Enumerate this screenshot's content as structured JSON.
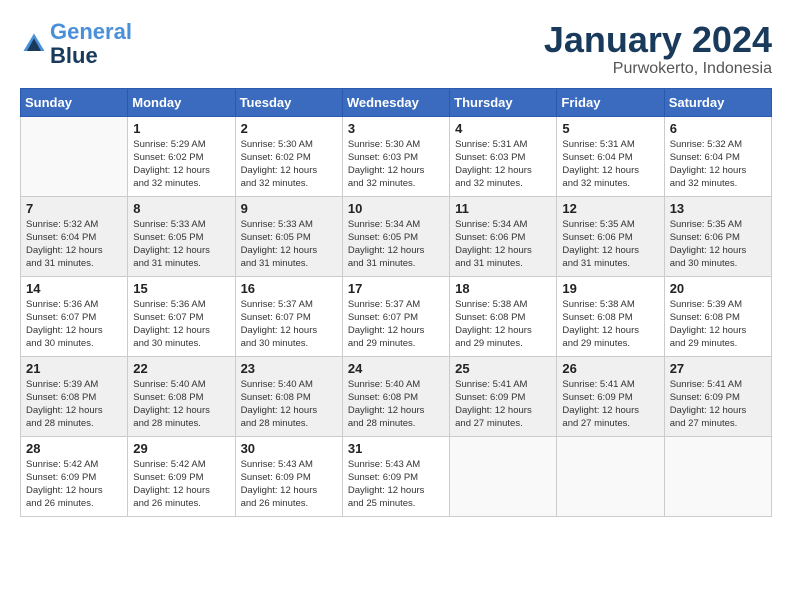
{
  "logo": {
    "line1": "General",
    "line2": "Blue"
  },
  "title": "January 2024",
  "subtitle": "Purwokerto, Indonesia",
  "days_of_week": [
    "Sunday",
    "Monday",
    "Tuesday",
    "Wednesday",
    "Thursday",
    "Friday",
    "Saturday"
  ],
  "weeks": [
    [
      {
        "day": "",
        "info": ""
      },
      {
        "day": "1",
        "info": "Sunrise: 5:29 AM\nSunset: 6:02 PM\nDaylight: 12 hours\nand 32 minutes."
      },
      {
        "day": "2",
        "info": "Sunrise: 5:30 AM\nSunset: 6:02 PM\nDaylight: 12 hours\nand 32 minutes."
      },
      {
        "day": "3",
        "info": "Sunrise: 5:30 AM\nSunset: 6:03 PM\nDaylight: 12 hours\nand 32 minutes."
      },
      {
        "day": "4",
        "info": "Sunrise: 5:31 AM\nSunset: 6:03 PM\nDaylight: 12 hours\nand 32 minutes."
      },
      {
        "day": "5",
        "info": "Sunrise: 5:31 AM\nSunset: 6:04 PM\nDaylight: 12 hours\nand 32 minutes."
      },
      {
        "day": "6",
        "info": "Sunrise: 5:32 AM\nSunset: 6:04 PM\nDaylight: 12 hours\nand 32 minutes."
      }
    ],
    [
      {
        "day": "7",
        "info": "Sunrise: 5:32 AM\nSunset: 6:04 PM\nDaylight: 12 hours\nand 31 minutes."
      },
      {
        "day": "8",
        "info": "Sunrise: 5:33 AM\nSunset: 6:05 PM\nDaylight: 12 hours\nand 31 minutes."
      },
      {
        "day": "9",
        "info": "Sunrise: 5:33 AM\nSunset: 6:05 PM\nDaylight: 12 hours\nand 31 minutes."
      },
      {
        "day": "10",
        "info": "Sunrise: 5:34 AM\nSunset: 6:05 PM\nDaylight: 12 hours\nand 31 minutes."
      },
      {
        "day": "11",
        "info": "Sunrise: 5:34 AM\nSunset: 6:06 PM\nDaylight: 12 hours\nand 31 minutes."
      },
      {
        "day": "12",
        "info": "Sunrise: 5:35 AM\nSunset: 6:06 PM\nDaylight: 12 hours\nand 31 minutes."
      },
      {
        "day": "13",
        "info": "Sunrise: 5:35 AM\nSunset: 6:06 PM\nDaylight: 12 hours\nand 30 minutes."
      }
    ],
    [
      {
        "day": "14",
        "info": "Sunrise: 5:36 AM\nSunset: 6:07 PM\nDaylight: 12 hours\nand 30 minutes."
      },
      {
        "day": "15",
        "info": "Sunrise: 5:36 AM\nSunset: 6:07 PM\nDaylight: 12 hours\nand 30 minutes."
      },
      {
        "day": "16",
        "info": "Sunrise: 5:37 AM\nSunset: 6:07 PM\nDaylight: 12 hours\nand 30 minutes."
      },
      {
        "day": "17",
        "info": "Sunrise: 5:37 AM\nSunset: 6:07 PM\nDaylight: 12 hours\nand 29 minutes."
      },
      {
        "day": "18",
        "info": "Sunrise: 5:38 AM\nSunset: 6:08 PM\nDaylight: 12 hours\nand 29 minutes."
      },
      {
        "day": "19",
        "info": "Sunrise: 5:38 AM\nSunset: 6:08 PM\nDaylight: 12 hours\nand 29 minutes."
      },
      {
        "day": "20",
        "info": "Sunrise: 5:39 AM\nSunset: 6:08 PM\nDaylight: 12 hours\nand 29 minutes."
      }
    ],
    [
      {
        "day": "21",
        "info": "Sunrise: 5:39 AM\nSunset: 6:08 PM\nDaylight: 12 hours\nand 28 minutes."
      },
      {
        "day": "22",
        "info": "Sunrise: 5:40 AM\nSunset: 6:08 PM\nDaylight: 12 hours\nand 28 minutes."
      },
      {
        "day": "23",
        "info": "Sunrise: 5:40 AM\nSunset: 6:08 PM\nDaylight: 12 hours\nand 28 minutes."
      },
      {
        "day": "24",
        "info": "Sunrise: 5:40 AM\nSunset: 6:08 PM\nDaylight: 12 hours\nand 28 minutes."
      },
      {
        "day": "25",
        "info": "Sunrise: 5:41 AM\nSunset: 6:09 PM\nDaylight: 12 hours\nand 27 minutes."
      },
      {
        "day": "26",
        "info": "Sunrise: 5:41 AM\nSunset: 6:09 PM\nDaylight: 12 hours\nand 27 minutes."
      },
      {
        "day": "27",
        "info": "Sunrise: 5:41 AM\nSunset: 6:09 PM\nDaylight: 12 hours\nand 27 minutes."
      }
    ],
    [
      {
        "day": "28",
        "info": "Sunrise: 5:42 AM\nSunset: 6:09 PM\nDaylight: 12 hours\nand 26 minutes."
      },
      {
        "day": "29",
        "info": "Sunrise: 5:42 AM\nSunset: 6:09 PM\nDaylight: 12 hours\nand 26 minutes."
      },
      {
        "day": "30",
        "info": "Sunrise: 5:43 AM\nSunset: 6:09 PM\nDaylight: 12 hours\nand 26 minutes."
      },
      {
        "day": "31",
        "info": "Sunrise: 5:43 AM\nSunset: 6:09 PM\nDaylight: 12 hours\nand 25 minutes."
      },
      {
        "day": "",
        "info": ""
      },
      {
        "day": "",
        "info": ""
      },
      {
        "day": "",
        "info": ""
      }
    ]
  ]
}
